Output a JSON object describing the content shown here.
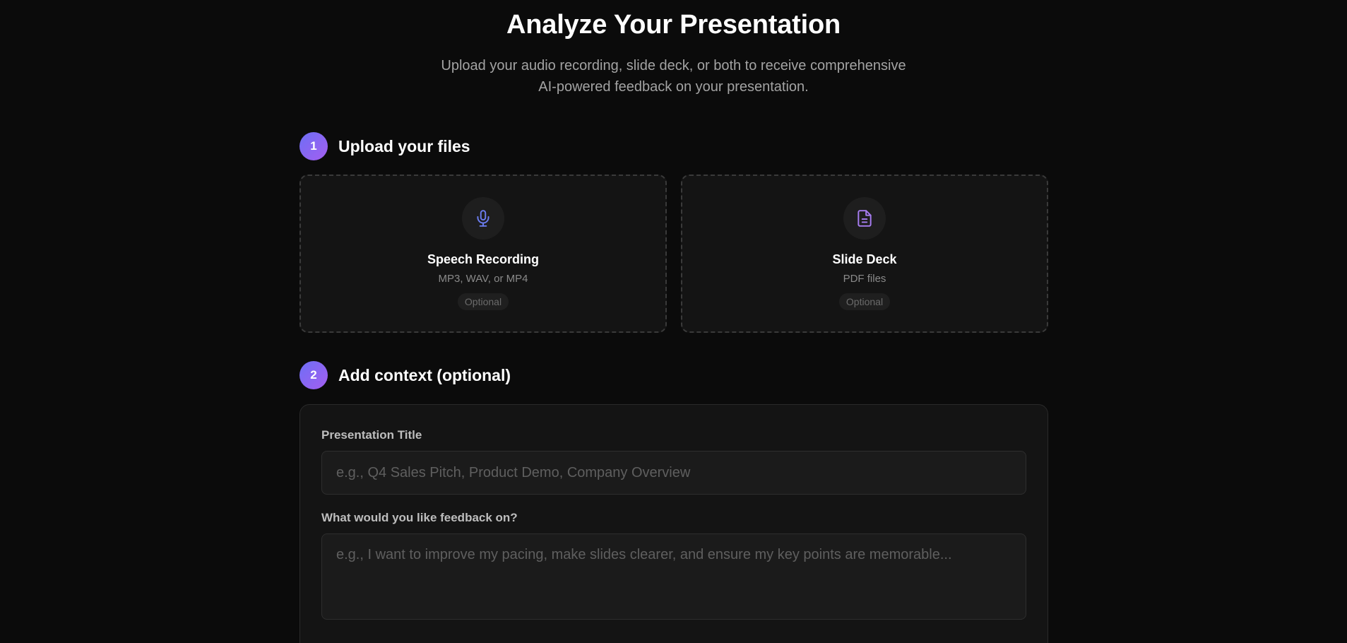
{
  "hero": {
    "title": "Analyze Your Presentation",
    "subtitle_line1": "Upload your audio recording, slide deck, or both to receive comprehensive",
    "subtitle_line2": "AI-powered feedback on your presentation."
  },
  "steps": [
    {
      "number": "1",
      "title": "Upload your files"
    },
    {
      "number": "2",
      "title": "Add context (optional)"
    }
  ],
  "uploads": [
    {
      "icon": "microphone-icon",
      "title": "Speech Recording",
      "desc": "MP3, WAV, or MP4",
      "tag": "Optional"
    },
    {
      "icon": "document-icon",
      "title": "Slide Deck",
      "desc": "PDF files",
      "tag": "Optional"
    }
  ],
  "context": {
    "title_label": "Presentation Title",
    "title_placeholder": "e.g., Q4 Sales Pitch, Product Demo, Company Overview",
    "feedback_label": "What would you like feedback on?",
    "feedback_placeholder": "e.g., I want to improve my pacing, make slides clearer, and ensure my key points are memorable..."
  },
  "colors": {
    "background": "#0b0b0b",
    "card": "#141414",
    "accent_start": "#6d6ff5",
    "accent_end": "#a45ef0",
    "mic_icon": "#6b7df0",
    "doc_icon": "#a77df2"
  }
}
